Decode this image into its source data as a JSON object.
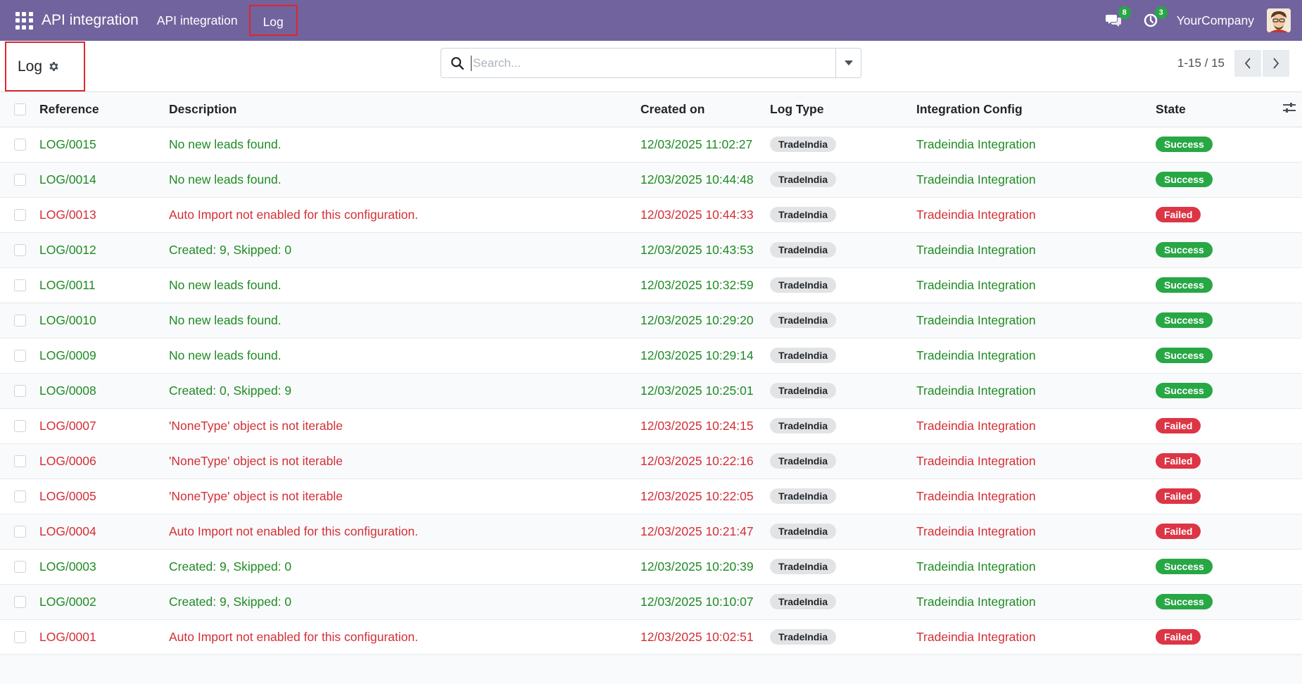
{
  "navbar": {
    "app_name": "API integration",
    "menu": [
      "API integration",
      "Log"
    ],
    "messages_count": "8",
    "activities_count": "3",
    "company": "YourCompany"
  },
  "control_panel": {
    "title": "Log",
    "search_placeholder": "Search...",
    "pager_value": "1-15 / 15"
  },
  "table": {
    "columns": [
      "Reference",
      "Description",
      "Created on",
      "Log Type",
      "Integration Config",
      "State"
    ],
    "rows": [
      {
        "status": "success",
        "reference": "LOG/0015",
        "description": "No new leads found.",
        "created_on": "12/03/2025 11:02:27",
        "log_type": "TradeIndia",
        "config": "Tradeindia Integration",
        "state": "Success"
      },
      {
        "status": "success",
        "reference": "LOG/0014",
        "description": "No new leads found.",
        "created_on": "12/03/2025 10:44:48",
        "log_type": "TradeIndia",
        "config": "Tradeindia Integration",
        "state": "Success"
      },
      {
        "status": "failed",
        "reference": "LOG/0013",
        "description": "Auto Import not enabled for this configuration.",
        "created_on": "12/03/2025 10:44:33",
        "log_type": "TradeIndia",
        "config": "Tradeindia Integration",
        "state": "Failed"
      },
      {
        "status": "success",
        "reference": "LOG/0012",
        "description": "Created: 9, Skipped: 0",
        "created_on": "12/03/2025 10:43:53",
        "log_type": "TradeIndia",
        "config": "Tradeindia Integration",
        "state": "Success"
      },
      {
        "status": "success",
        "reference": "LOG/0011",
        "description": "No new leads found.",
        "created_on": "12/03/2025 10:32:59",
        "log_type": "TradeIndia",
        "config": "Tradeindia Integration",
        "state": "Success"
      },
      {
        "status": "success",
        "reference": "LOG/0010",
        "description": "No new leads found.",
        "created_on": "12/03/2025 10:29:20",
        "log_type": "TradeIndia",
        "config": "Tradeindia Integration",
        "state": "Success"
      },
      {
        "status": "success",
        "reference": "LOG/0009",
        "description": "No new leads found.",
        "created_on": "12/03/2025 10:29:14",
        "log_type": "TradeIndia",
        "config": "Tradeindia Integration",
        "state": "Success"
      },
      {
        "status": "success",
        "reference": "LOG/0008",
        "description": "Created: 0, Skipped: 9",
        "created_on": "12/03/2025 10:25:01",
        "log_type": "TradeIndia",
        "config": "Tradeindia Integration",
        "state": "Success"
      },
      {
        "status": "failed",
        "reference": "LOG/0007",
        "description": "'NoneType' object is not iterable",
        "created_on": "12/03/2025 10:24:15",
        "log_type": "TradeIndia",
        "config": "Tradeindia Integration",
        "state": "Failed"
      },
      {
        "status": "failed",
        "reference": "LOG/0006",
        "description": "'NoneType' object is not iterable",
        "created_on": "12/03/2025 10:22:16",
        "log_type": "TradeIndia",
        "config": "Tradeindia Integration",
        "state": "Failed"
      },
      {
        "status": "failed",
        "reference": "LOG/0005",
        "description": "'NoneType' object is not iterable",
        "created_on": "12/03/2025 10:22:05",
        "log_type": "TradeIndia",
        "config": "Tradeindia Integration",
        "state": "Failed"
      },
      {
        "status": "failed",
        "reference": "LOG/0004",
        "description": "Auto Import not enabled for this configuration.",
        "created_on": "12/03/2025 10:21:47",
        "log_type": "TradeIndia",
        "config": "Tradeindia Integration",
        "state": "Failed"
      },
      {
        "status": "success",
        "reference": "LOG/0003",
        "description": "Created: 9, Skipped: 0",
        "created_on": "12/03/2025 10:20:39",
        "log_type": "TradeIndia",
        "config": "Tradeindia Integration",
        "state": "Success"
      },
      {
        "status": "success",
        "reference": "LOG/0002",
        "description": "Created: 9, Skipped: 0",
        "created_on": "12/03/2025 10:10:07",
        "log_type": "TradeIndia",
        "config": "Tradeindia Integration",
        "state": "Success"
      },
      {
        "status": "failed",
        "reference": "LOG/0001",
        "description": "Auto Import not enabled for this configuration.",
        "created_on": "12/03/2025 10:02:51",
        "log_type": "TradeIndia",
        "config": "Tradeindia Integration",
        "state": "Failed"
      }
    ]
  },
  "colors": {
    "navbar": "#71639e",
    "success_text": "#1f8b24",
    "failed_text": "#d32f36",
    "success_badge": "#28a745",
    "failed_badge": "#dc3545",
    "highlight_box": "#e0262c"
  },
  "icons": [
    "apps-grid-icon",
    "chat-bubbles-icon",
    "clock-activity-icon",
    "gear-icon",
    "search-icon",
    "caret-down-icon",
    "chevron-left-icon",
    "chevron-right-icon",
    "optional-columns-icon"
  ]
}
